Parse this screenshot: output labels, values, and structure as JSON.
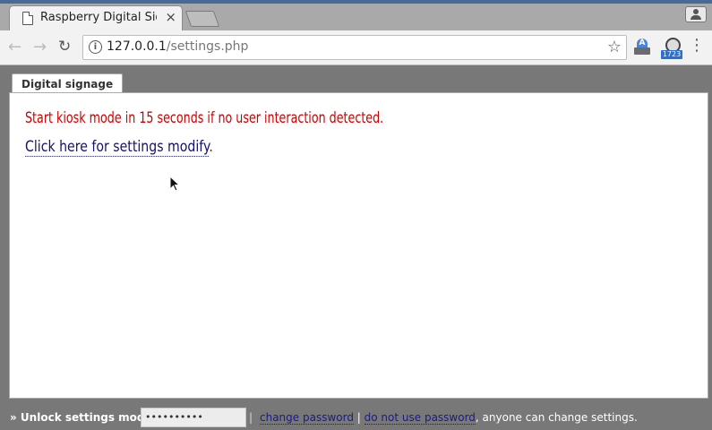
{
  "browser": {
    "tab_title": "Raspberry Digital Signage",
    "tab_close": "×",
    "url_host": "127.0.0.1",
    "url_path": "/settings.php",
    "badge_count": "1723",
    "icons": [
      "back-icon",
      "forward-icon",
      "reload-icon",
      "info-icon",
      "star-icon",
      "profile-icon",
      "menu-icon"
    ]
  },
  "page": {
    "tab_label": "Digital signage",
    "kiosk_message": "Start kiosk mode in 15 seconds if no user interaction detected.",
    "settings_link_text": "Click here for settings modify",
    "settings_link_suffix": "."
  },
  "footer": {
    "unlock_label": "» Unlock settings modify",
    "unlock_colon": ":",
    "password_value": "••••••••••",
    "separator": "|",
    "change_password": "change password",
    "link_separator": "|",
    "no_password": "do not use password",
    "no_password_tail": ", anyone can change settings."
  }
}
